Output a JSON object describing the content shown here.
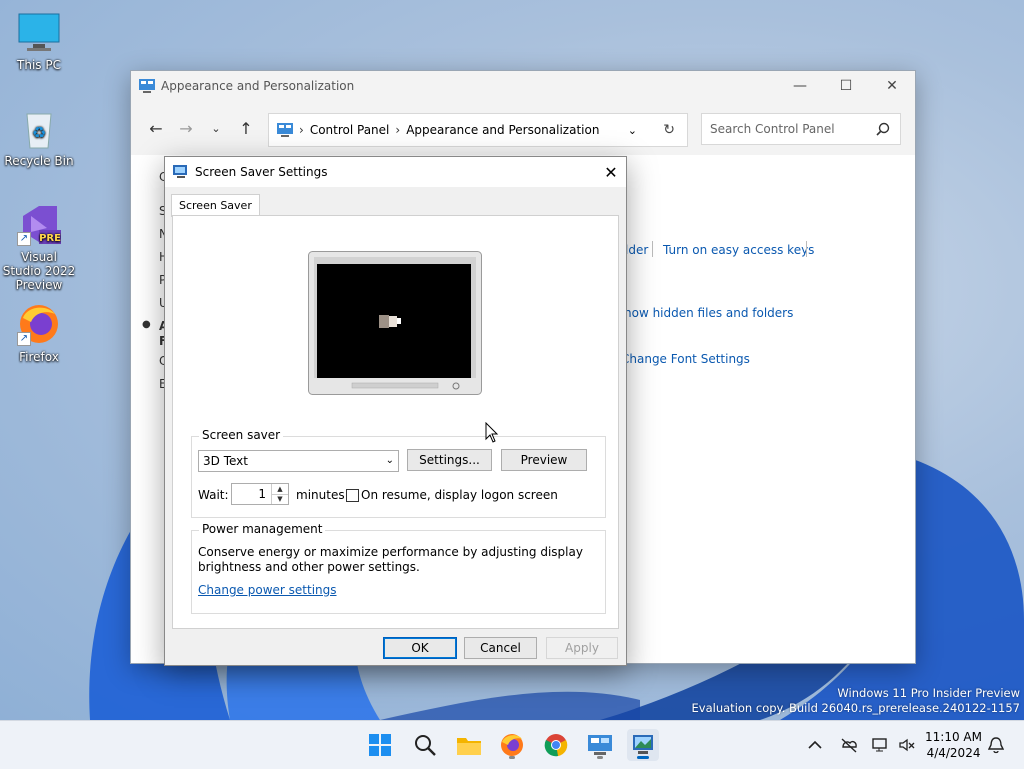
{
  "desktop": {
    "icons": [
      {
        "label": "This PC",
        "icon": "monitor-icon"
      },
      {
        "label": "Recycle Bin",
        "icon": "recycle-bin-icon"
      },
      {
        "label": "Visual Studio 2022 Preview",
        "icon": "visual-studio-icon",
        "badge": "PRE"
      },
      {
        "label": "Firefox",
        "icon": "firefox-icon"
      }
    ]
  },
  "control_panel": {
    "title": "Appearance and Personalization",
    "breadcrumb": [
      "Control Panel",
      "Appearance and Personalization"
    ],
    "search_placeholder": "Search Control Panel",
    "links": {
      "folder_fragment": "lder",
      "easy_access": "Turn on easy access keys",
      "hidden_files": "how hidden files and folders",
      "font_settings": "Change Font Settings"
    },
    "left_letters": [
      "C",
      "S",
      "N",
      "H",
      "P",
      "U",
      "A",
      "F",
      "C",
      "E"
    ]
  },
  "dialog": {
    "title": "Screen Saver Settings",
    "tab": "Screen Saver",
    "screen_saver_group": "Screen saver",
    "selected_saver": "3D Text",
    "settings_button": "Settings...",
    "preview_button": "Preview",
    "wait_label": "Wait:",
    "wait_value": "1",
    "minutes_label": "minutes",
    "resume_label": "On resume, display logon screen",
    "resume_checked": false,
    "power_group": "Power management",
    "power_text_1": "Conserve energy or maximize performance by adjusting display",
    "power_text_2": "brightness and other power settings.",
    "power_link": "Change power settings",
    "ok": "OK",
    "cancel": "Cancel",
    "apply": "Apply"
  },
  "watermark": {
    "line1": "Windows 11 Pro Insider Preview",
    "line2": "Evaluation copy. Build 26040.rs_prerelease.240122-1157"
  },
  "taskbar": {
    "apps": [
      "start-icon",
      "search-icon",
      "file-explorer-icon",
      "firefox-icon",
      "chrome-icon",
      "control-panel-icon",
      "screen-saver-icon"
    ],
    "clock_time": "11:10 AM",
    "clock_date": "4/4/2024"
  },
  "colors": {
    "accent": "#0067c0",
    "link": "#0b59b0"
  }
}
